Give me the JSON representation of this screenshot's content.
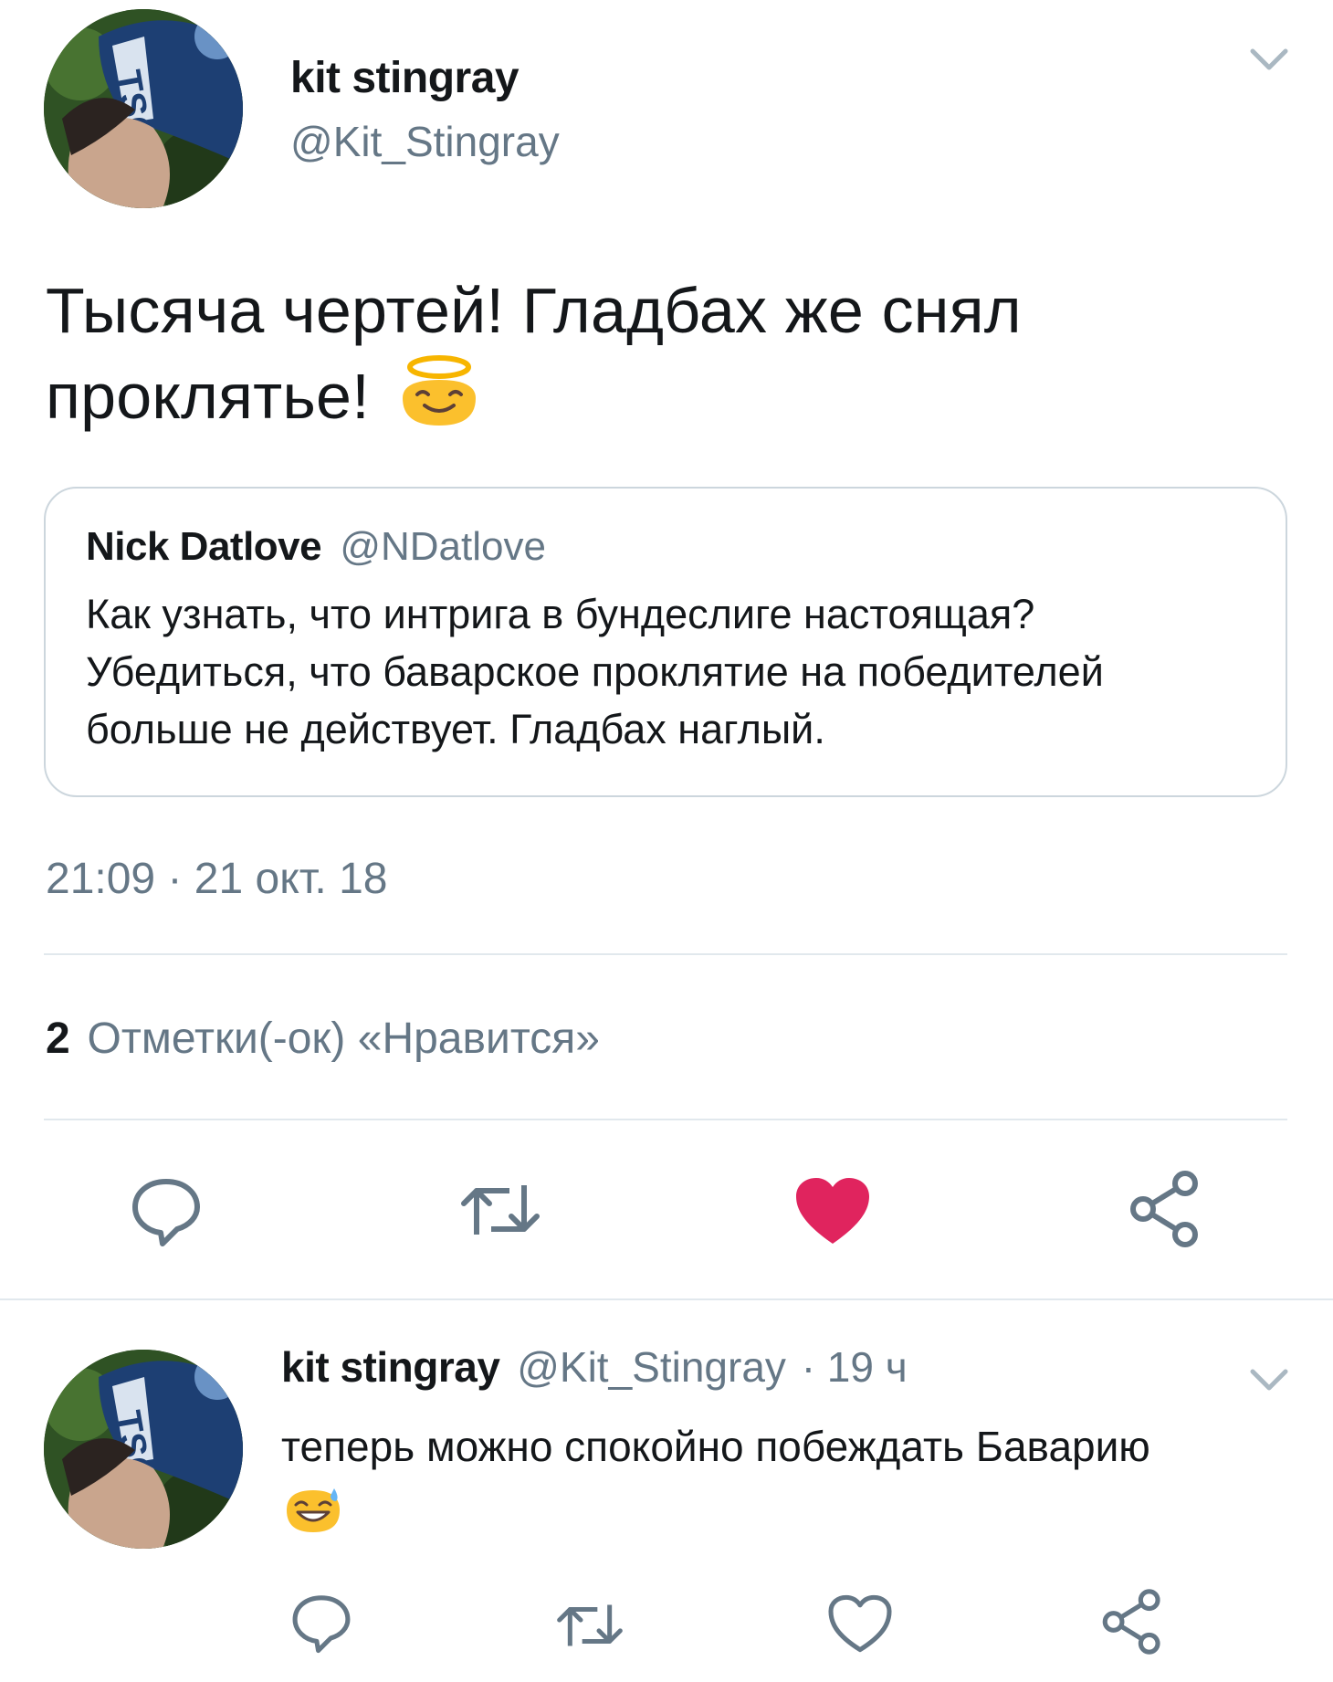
{
  "main_tweet": {
    "author_name": "kit stingray",
    "author_handle": "@Kit_Stingray",
    "text": "Тысяча чертей! Гладбах же снял проклятье!",
    "emoji": "smiling-face-with-halo",
    "timestamp": "21:09 · 21 окт. 18",
    "likes_count": "2",
    "likes_label": "Отметки(-ок) «Нравится»",
    "liked": true
  },
  "quoted_tweet": {
    "author_name": "Nick Datlove",
    "author_handle": "@NDatlove",
    "text": "Как узнать, что интрига в бундеслиге настоящая? Убедиться, что баварское проклятие на победителей больше не действует. Гладбах наглый."
  },
  "reply": {
    "author_name": "kit stingray",
    "author_handle": "@Kit_Stingray",
    "time_ago": "· 19 ч",
    "text": "теперь можно спокойно побеждать Баварию",
    "emoji": "smiling-face-with-open-mouth-and-cold-sweat",
    "liked": false
  },
  "colors": {
    "text": "#14171a",
    "muted": "#657786",
    "like_active": "#e0245e",
    "divider": "#e1e8ed",
    "icon": "#657786"
  },
  "icons": {
    "reply": "reply-icon",
    "retweet": "retweet-icon",
    "like": "heart-icon",
    "share": "share-icon",
    "menu": "chevron-down-icon"
  }
}
